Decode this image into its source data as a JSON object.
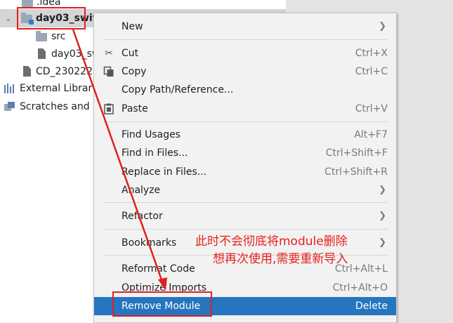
{
  "tree": {
    "idea": ".idea",
    "project": "day03_swit",
    "src": "src",
    "iml": "day03_sw",
    "cd": "CD_230222",
    "external": "External Librar",
    "scratches": "Scratches and"
  },
  "menu": {
    "new": "New",
    "cut": "Cut",
    "cut_key": "Ctrl+X",
    "copy": "Copy",
    "copy_key": "Ctrl+C",
    "copy_path": "Copy Path/Reference...",
    "paste": "Paste",
    "paste_key": "Ctrl+V",
    "find_usages": "Find Usages",
    "find_usages_key": "Alt+F7",
    "find_in_files": "Find in Files...",
    "find_in_files_key": "Ctrl+Shift+F",
    "replace_in_files": "Replace in Files...",
    "replace_in_files_key": "Ctrl+Shift+R",
    "analyze": "Analyze",
    "refactor": "Refactor",
    "bookmarks": "Bookmarks",
    "reformat": "Reformat Code",
    "reformat_key": "Ctrl+Alt+L",
    "optimize": "Optimize Imports",
    "optimize_key": "Ctrl+Alt+O",
    "remove": "Remove Module",
    "remove_key": "Delete"
  },
  "annotation": {
    "line1": "此时不会彻底将module删除",
    "line2": "想再次使用,需要重新导入"
  },
  "colors": {
    "highlight": "#2675bf",
    "annotation": "#e8201c"
  }
}
